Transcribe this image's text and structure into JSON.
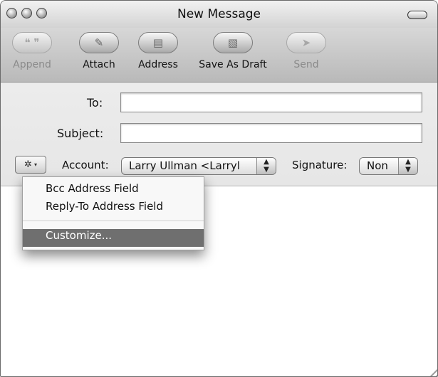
{
  "window": {
    "title": "New Message"
  },
  "toolbar": {
    "buttons": [
      {
        "label": "Append",
        "icon": "append-icon",
        "enabled": false
      },
      {
        "label": "Attach",
        "icon": "paperclip-icon",
        "enabled": true
      },
      {
        "label": "Address",
        "icon": "address-book-icon",
        "enabled": true
      },
      {
        "label": "Save As Draft",
        "icon": "draft-icon",
        "enabled": true
      },
      {
        "label": "Send",
        "icon": "paper-plane-icon",
        "enabled": false
      }
    ]
  },
  "header": {
    "to_label": "To:",
    "to_value": "",
    "subject_label": "Subject:",
    "subject_value": "",
    "account_label": "Account:",
    "account_value": "Larry Ullman <Larryl",
    "signature_label": "Signature:",
    "signature_value": "Non"
  },
  "action_menu": {
    "items": [
      {
        "label": "Bcc Address Field",
        "highlighted": false
      },
      {
        "label": "Reply-To Address Field",
        "highlighted": false
      },
      {
        "label": "Customize...",
        "highlighted": true
      }
    ]
  },
  "colors": {
    "highlight": "#6f6f6f",
    "toolbar": "#c8c8c8"
  }
}
